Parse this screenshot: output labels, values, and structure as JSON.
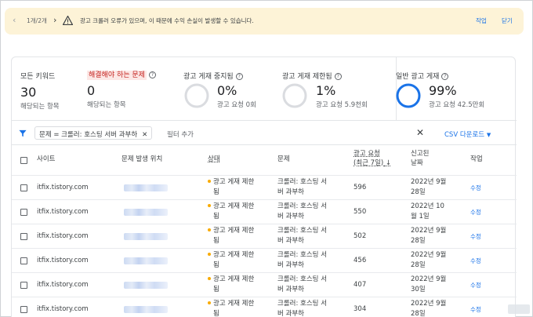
{
  "banner": {
    "pager": "1개/2개",
    "message": "광고 크롤러 오류가 있으며, 이 때문에 수익 손실이 발생할 수 있습니다.",
    "action_label": "작업",
    "close_label": "닫기",
    "warning_color": "#3c4043",
    "background": "#fdf3d7"
  },
  "summary": {
    "all_keywords": {
      "label": "모든 키워드",
      "value": "30",
      "sub": "해당되는 항목"
    },
    "to_fix": {
      "label": "해결해야 하는 문제",
      "value": "0",
      "sub": "해당되는 항목"
    },
    "ads_stopped": {
      "label": "광고 게재 중지됨",
      "value": "0%",
      "sub": "광고 요청 0회",
      "fraction": 0.0
    },
    "ads_limited": {
      "label": "광고 게재 제한됨",
      "value": "1%",
      "sub": "광고 요청 5.9천회",
      "fraction": 0.01
    },
    "ads_normal": {
      "label": "일반 광고 게재",
      "value": "99%",
      "sub": "광고 요청 42.5만회",
      "fraction": 0.99
    }
  },
  "filter": {
    "chip_label": "문제 = 크롤러: 호스팅 서버 과부하",
    "add_filter_placeholder": "필터 추가",
    "csv_label": "CSV 다운로드"
  },
  "table": {
    "headers": {
      "site": "사이트",
      "location": "문제 발생 위치",
      "status": "상태",
      "issue": "문제",
      "requests_line1": "광고 요청",
      "requests_line2": "(최근 7일)",
      "reported_line1": "신고된",
      "reported_line2": "날짜",
      "action": "작업"
    },
    "rows": [
      {
        "site": "itfix.tistory.com",
        "status1": "광고 게재 제한",
        "status2": "됨",
        "issue1": "크롤러: 호스팅 서",
        "issue2": "버 과부하",
        "requests": "596",
        "date1": "2022년 9월",
        "date2": "28일",
        "action": "수정"
      },
      {
        "site": "itfix.tistory.com",
        "status1": "광고 게재 제한",
        "status2": "됨",
        "issue1": "크롤러: 호스팅 서",
        "issue2": "버 과부하",
        "requests": "550",
        "date1": "2022년 10",
        "date2": "월 1일",
        "action": "수정"
      },
      {
        "site": "itfix.tistory.com",
        "status1": "광고 게재 제한",
        "status2": "됨",
        "issue1": "크롤러: 호스팅 서",
        "issue2": "버 과부하",
        "requests": "502",
        "date1": "2022년 9월",
        "date2": "28일",
        "action": "수정"
      },
      {
        "site": "itfix.tistory.com",
        "status1": "광고 게재 제한",
        "status2": "됨",
        "issue1": "크롤러: 호스팅 서",
        "issue2": "버 과부하",
        "requests": "456",
        "date1": "2022년 9월",
        "date2": "28일",
        "action": "수정"
      },
      {
        "site": "itfix.tistory.com",
        "status1": "광고 게재 제한",
        "status2": "됨",
        "issue1": "크롤러: 호스팅 서",
        "issue2": "버 과부하",
        "requests": "407",
        "date1": "2022년 9월",
        "date2": "30일",
        "action": "수정"
      },
      {
        "site": "itfix.tistory.com",
        "status1": "광고 게재 제한",
        "status2": "됨",
        "issue1": "크롤러: 호스팅 서",
        "issue2": "버 과부하",
        "requests": "304",
        "date1": "2022년 9월",
        "date2": "28일",
        "action": "수정"
      }
    ]
  },
  "colors": {
    "accent": "#1a73e8",
    "warning_status": "#f9ab00",
    "flag_bg": "#fce8e6",
    "flag_text": "#c5221f"
  }
}
